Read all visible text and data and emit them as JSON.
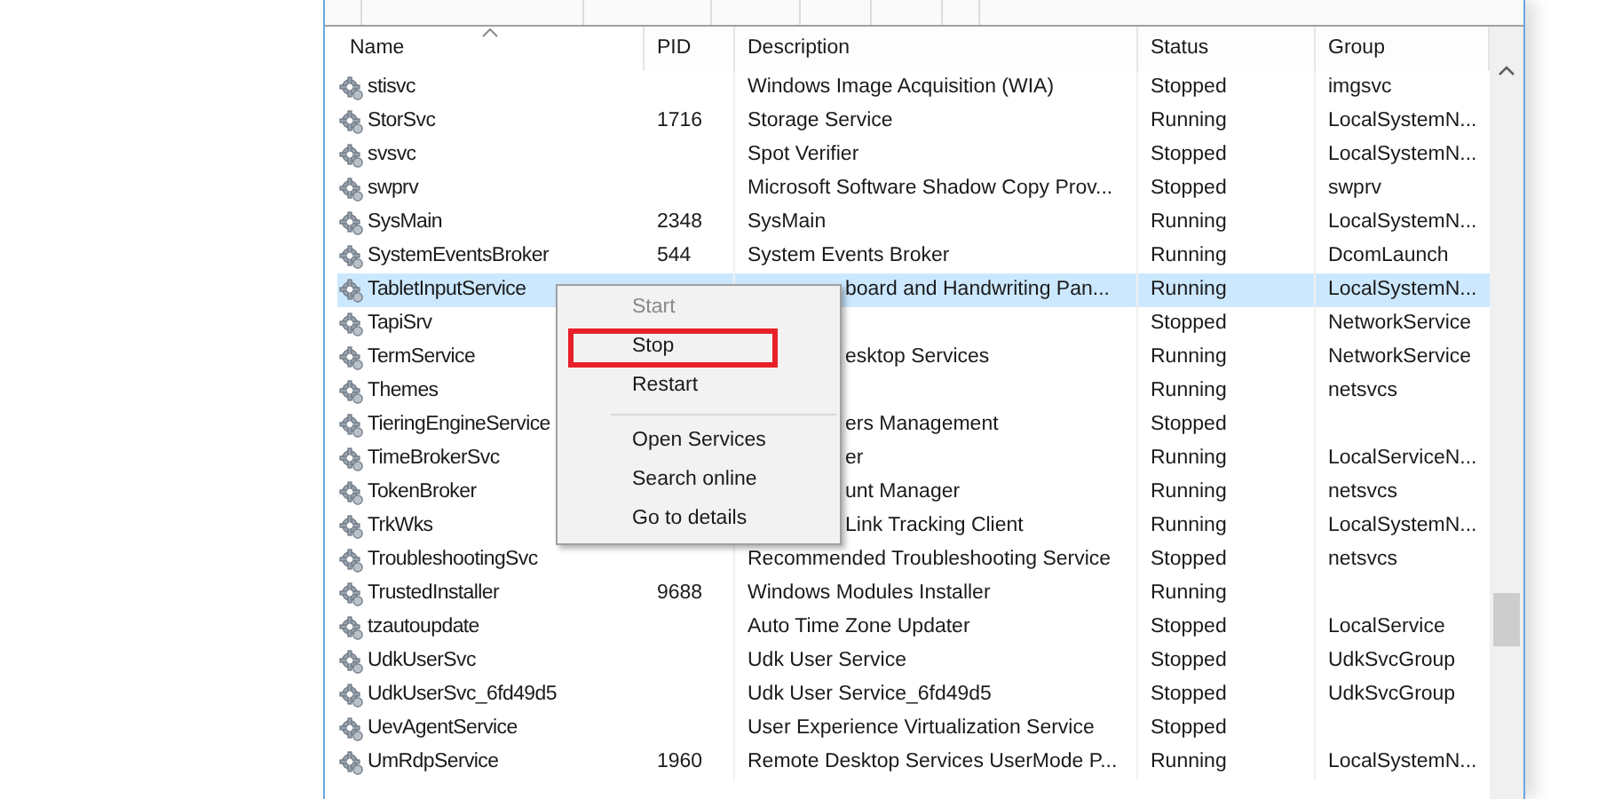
{
  "table": {
    "columns": [
      {
        "label": "Name",
        "sorted": true
      },
      {
        "label": "PID",
        "sorted": false
      },
      {
        "label": "Description",
        "sorted": false
      },
      {
        "label": "Status",
        "sorted": false
      },
      {
        "label": "Group",
        "sorted": false
      }
    ],
    "rows": [
      {
        "name": "stisvc",
        "pid": "",
        "description": "Windows Image Acquisition (WIA)",
        "status": "Stopped",
        "group": "imgsvc",
        "selected": false
      },
      {
        "name": "StorSvc",
        "pid": "1716",
        "description": "Storage Service",
        "status": "Running",
        "group": "LocalSystemN...",
        "selected": false
      },
      {
        "name": "svsvc",
        "pid": "",
        "description": "Spot Verifier",
        "status": "Stopped",
        "group": "LocalSystemN...",
        "selected": false
      },
      {
        "name": "swprv",
        "pid": "",
        "description": "Microsoft Software Shadow Copy Prov...",
        "status": "Stopped",
        "group": "swprv",
        "selected": false
      },
      {
        "name": "SysMain",
        "pid": "2348",
        "description": "SysMain",
        "status": "Running",
        "group": "LocalSystemN...",
        "selected": false
      },
      {
        "name": "SystemEventsBroker",
        "pid": "544",
        "description": "System Events Broker",
        "status": "Running",
        "group": "DcomLaunch",
        "selected": false
      },
      {
        "name": "TabletInputService",
        "pid": "",
        "description_tail": "board and Handwriting Pan...",
        "status": "Running",
        "group": "LocalSystemN...",
        "selected": true
      },
      {
        "name": "TapiSrv",
        "pid": "",
        "status": "Stopped",
        "group": "NetworkService",
        "selected": false
      },
      {
        "name": "TermService",
        "pid": "",
        "description_tail": "esktop Services",
        "status": "Running",
        "group": "NetworkService",
        "selected": false
      },
      {
        "name": "Themes",
        "pid": "",
        "status": "Running",
        "group": "netsvcs",
        "selected": false
      },
      {
        "name": "TieringEngineService",
        "pid": "",
        "description_tail": "ers Management",
        "status": "Stopped",
        "group": "",
        "selected": false
      },
      {
        "name": "TimeBrokerSvc",
        "pid": "",
        "description_tail": "er",
        "status": "Running",
        "group": "LocalServiceN...",
        "selected": false
      },
      {
        "name": "TokenBroker",
        "pid": "",
        "description_tail": "unt Manager",
        "status": "Running",
        "group": "netsvcs",
        "selected": false
      },
      {
        "name": "TrkWks",
        "pid": "",
        "description_tail": "Link Tracking Client",
        "status": "Running",
        "group": "LocalSystemN...",
        "selected": false
      },
      {
        "name": "TroubleshootingSvc",
        "pid": "",
        "description": "Recommended Troubleshooting Service",
        "status": "Stopped",
        "group": "netsvcs",
        "selected": false
      },
      {
        "name": "TrustedInstaller",
        "pid": "9688",
        "description": "Windows Modules Installer",
        "status": "Running",
        "group": "",
        "selected": false
      },
      {
        "name": "tzautoupdate",
        "pid": "",
        "description": "Auto Time Zone Updater",
        "status": "Stopped",
        "group": "LocalService",
        "selected": false
      },
      {
        "name": "UdkUserSvc",
        "pid": "",
        "description": "Udk User Service",
        "status": "Stopped",
        "group": "UdkSvcGroup",
        "selected": false
      },
      {
        "name": "UdkUserSvc_6fd49d5",
        "pid": "",
        "description": "Udk User Service_6fd49d5",
        "status": "Stopped",
        "group": "UdkSvcGroup",
        "selected": false
      },
      {
        "name": "UevAgentService",
        "pid": "",
        "description": "User Experience Virtualization Service",
        "status": "Stopped",
        "group": "",
        "selected": false
      },
      {
        "name": "UmRdpService",
        "pid": "1960",
        "description": "Remote Desktop Services UserMode P...",
        "status": "Running",
        "group": "LocalSystemN...",
        "selected": false
      }
    ]
  },
  "context_menu": {
    "items": [
      {
        "kind": "item",
        "label": "Start",
        "disabled": true,
        "highlighted": false
      },
      {
        "kind": "item",
        "label": "Stop",
        "disabled": false,
        "highlighted": true
      },
      {
        "kind": "item",
        "label": "Restart",
        "disabled": false,
        "highlighted": false
      },
      {
        "kind": "separator"
      },
      {
        "kind": "item",
        "label": "Open Services",
        "disabled": false,
        "highlighted": false
      },
      {
        "kind": "item",
        "label": "Search online",
        "disabled": false,
        "highlighted": false
      },
      {
        "kind": "item",
        "label": "Go to details",
        "disabled": false,
        "highlighted": false
      }
    ]
  }
}
